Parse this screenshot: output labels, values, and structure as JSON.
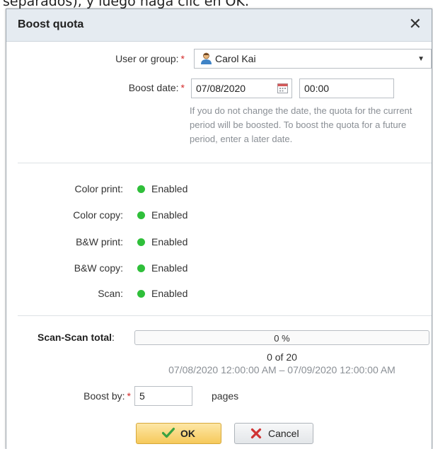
{
  "background_doc": {
    "text": "separados), y luego haga clic en OK."
  },
  "dialog": {
    "title": "Boost quota",
    "close_icon": "close-icon"
  },
  "form": {
    "user_label": "User or group:",
    "user_value": "Carol Kai",
    "boost_date_label": "Boost date:",
    "date_value": "07/08/2020",
    "time_value": "00:00",
    "help_text": "If you do not change the date, the quota for the current period will be boosted. To boost the quota for a future period, enter a later date.",
    "required_mark": "*"
  },
  "permissions": [
    {
      "label": "Color print:",
      "value": "Enabled"
    },
    {
      "label": "Color copy:",
      "value": "Enabled"
    },
    {
      "label": "B&W print:",
      "value": "Enabled"
    },
    {
      "label": "B&W copy:",
      "value": "Enabled"
    },
    {
      "label": "Scan:",
      "value": "Enabled"
    }
  ],
  "quota": {
    "label": "Scan-Scan total",
    "colon": ":",
    "progress_text": "0 %",
    "progress_fraction": 0,
    "count_text": "0 of 20",
    "range_text": "07/08/2020 12:00:00 AM – 07/09/2020 12:00:00 AM"
  },
  "boost": {
    "label": "Boost by:",
    "value": "5",
    "unit": "pages"
  },
  "buttons": {
    "ok_label": "OK",
    "cancel_label": "Cancel"
  },
  "colors": {
    "status_enabled": "#2fbf3a",
    "required": "#d42a2a",
    "titlebar": "#e5ebf1",
    "ok_button": "#f6c95b"
  },
  "icons": {
    "user": "user-icon",
    "calendar": "calendar-icon",
    "dropdown": "chevron-down-icon",
    "ok": "check-icon",
    "cancel": "x-icon",
    "status": "status-dot-icon"
  }
}
